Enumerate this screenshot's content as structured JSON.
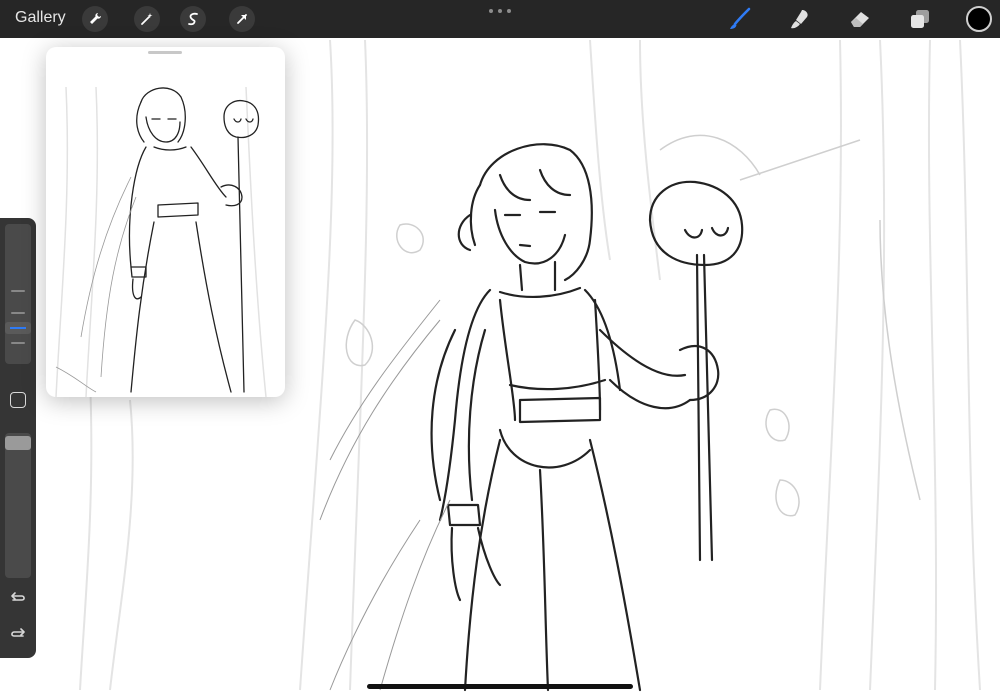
{
  "topbar": {
    "gallery_label": "Gallery",
    "left_tools": [
      "wrench-icon",
      "magic-wand-icon",
      "selection-icon",
      "transform-arrow-icon"
    ],
    "right_tools": [
      "brush-icon",
      "smudge-icon",
      "eraser-icon",
      "layers-icon"
    ],
    "active_tool": "brush-icon",
    "active_color": "#2f7bf5",
    "current_color": "#000000"
  },
  "sidebar": {
    "controls": [
      "brush-size-slider",
      "modify-button",
      "opacity-slider",
      "undo-button",
      "redo-button"
    ]
  },
  "reference": {
    "visible": true
  }
}
